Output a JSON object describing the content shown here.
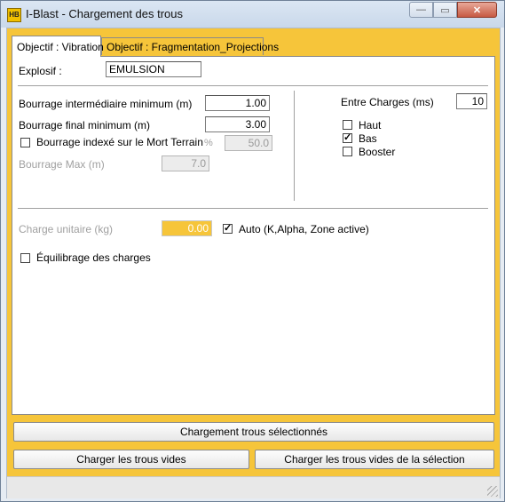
{
  "window": {
    "title": "I-Blast - Chargement des trous",
    "icon_text": "HB",
    "min_symbol": "—",
    "max_symbol": "▭",
    "close_symbol": "✕"
  },
  "tabs": {
    "vibration": "Objectif  : Vibration",
    "fragmentation": "Objectif : Fragmentation_Projections"
  },
  "form": {
    "explosif_label": "Explosif :",
    "explosif_value": "EMULSION",
    "bourrage_inter_label": "Bourrage intermédiaire minimum (m)",
    "bourrage_inter_value": "1.00",
    "bourrage_final_label": "Bourrage final minimum (m)",
    "bourrage_final_value": "3.00",
    "bourrage_indexe_label": "Bourrage indexé sur le Mort Terrain",
    "bourrage_indexe_checked": false,
    "percent_label": "%",
    "percent_value": "50.0",
    "bourrage_max_label": "Bourrage Max (m)",
    "bourrage_max_value": "7.0",
    "entre_charges_label": "Entre Charges (ms)",
    "entre_charges_value": "10",
    "haut_label": "Haut",
    "haut_checked": false,
    "bas_label": "Bas",
    "bas_checked": true,
    "booster_label": "Booster",
    "booster_checked": false,
    "charge_unitaire_label": "Charge unitaire (kg)",
    "charge_unitaire_value": "0.00",
    "auto_label": "Auto (K,Alpha, Zone active)",
    "auto_checked": true,
    "equilibrage_label": "Équilibrage des charges",
    "equilibrage_checked": false
  },
  "buttons": {
    "chargement_selection": "Chargement trous sélectionnés",
    "charger_vides": "Charger les trous vides",
    "charger_vides_selection": "Charger les trous vides de la sélection"
  },
  "colors": {
    "accent": "#f6c53a",
    "close_button": "#c75a43"
  }
}
